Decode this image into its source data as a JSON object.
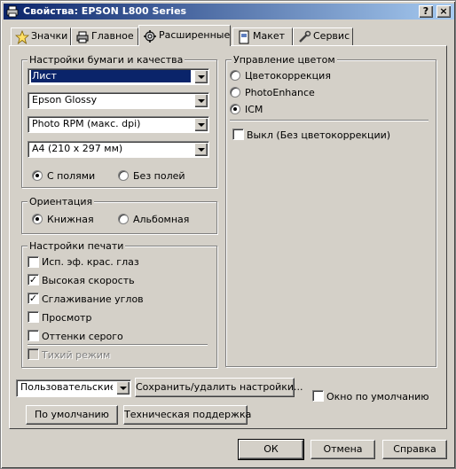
{
  "window": {
    "title": "Свойства: EPSON L800 Series"
  },
  "title_buttons": {
    "help": "?",
    "close": "×"
  },
  "tabs": [
    {
      "label": "Значки",
      "icon": "star-icon",
      "active": false
    },
    {
      "label": "Главное",
      "icon": "printer-icon",
      "active": false
    },
    {
      "label": "Расширенные",
      "icon": "settings-icon",
      "active": true
    },
    {
      "label": "Макет",
      "icon": "page-layout-icon",
      "active": false
    },
    {
      "label": "Сервис",
      "icon": "tools-icon",
      "active": false
    }
  ],
  "paper_quality": {
    "title": "Настройки бумаги и качества",
    "source": "Лист",
    "media": "Epson Glossy",
    "quality": "Photo RPM (макс. dpi)",
    "size": "A4 (210 x 297 мм)",
    "with_margins": "С полями",
    "borderless": "Без полей"
  },
  "orientation": {
    "title": "Ориентация",
    "portrait": "Книжная",
    "landscape": "Альбомная"
  },
  "print_settings": {
    "title": "Настройки печати",
    "items": [
      {
        "label": "Исп. эф. крас. глаз",
        "checked": false
      },
      {
        "label": "Высокая скорость",
        "checked": true
      },
      {
        "label": "Сглаживание углов",
        "checked": true
      },
      {
        "label": "Просмотр",
        "checked": false
      },
      {
        "label": "Оттенки серого",
        "checked": false
      }
    ],
    "quiet_mode": "Тихий режим"
  },
  "color_management": {
    "title": "Управление цветом",
    "options": [
      "Цветокоррекция",
      "PhotoEnhance",
      "ICM"
    ],
    "selected": "ICM",
    "off_label": "Выкл (Без цветокоррекции)"
  },
  "bottom": {
    "custom_select": "Пользовательские",
    "save_delete": "Сохранить/удалить настройки...",
    "default_window": "Окно по умолчанию",
    "defaults": "По умолчанию",
    "support": "Техническая поддержка"
  },
  "dialog_buttons": {
    "ok": "ОК",
    "cancel": "Отмена",
    "help": "Справка"
  }
}
